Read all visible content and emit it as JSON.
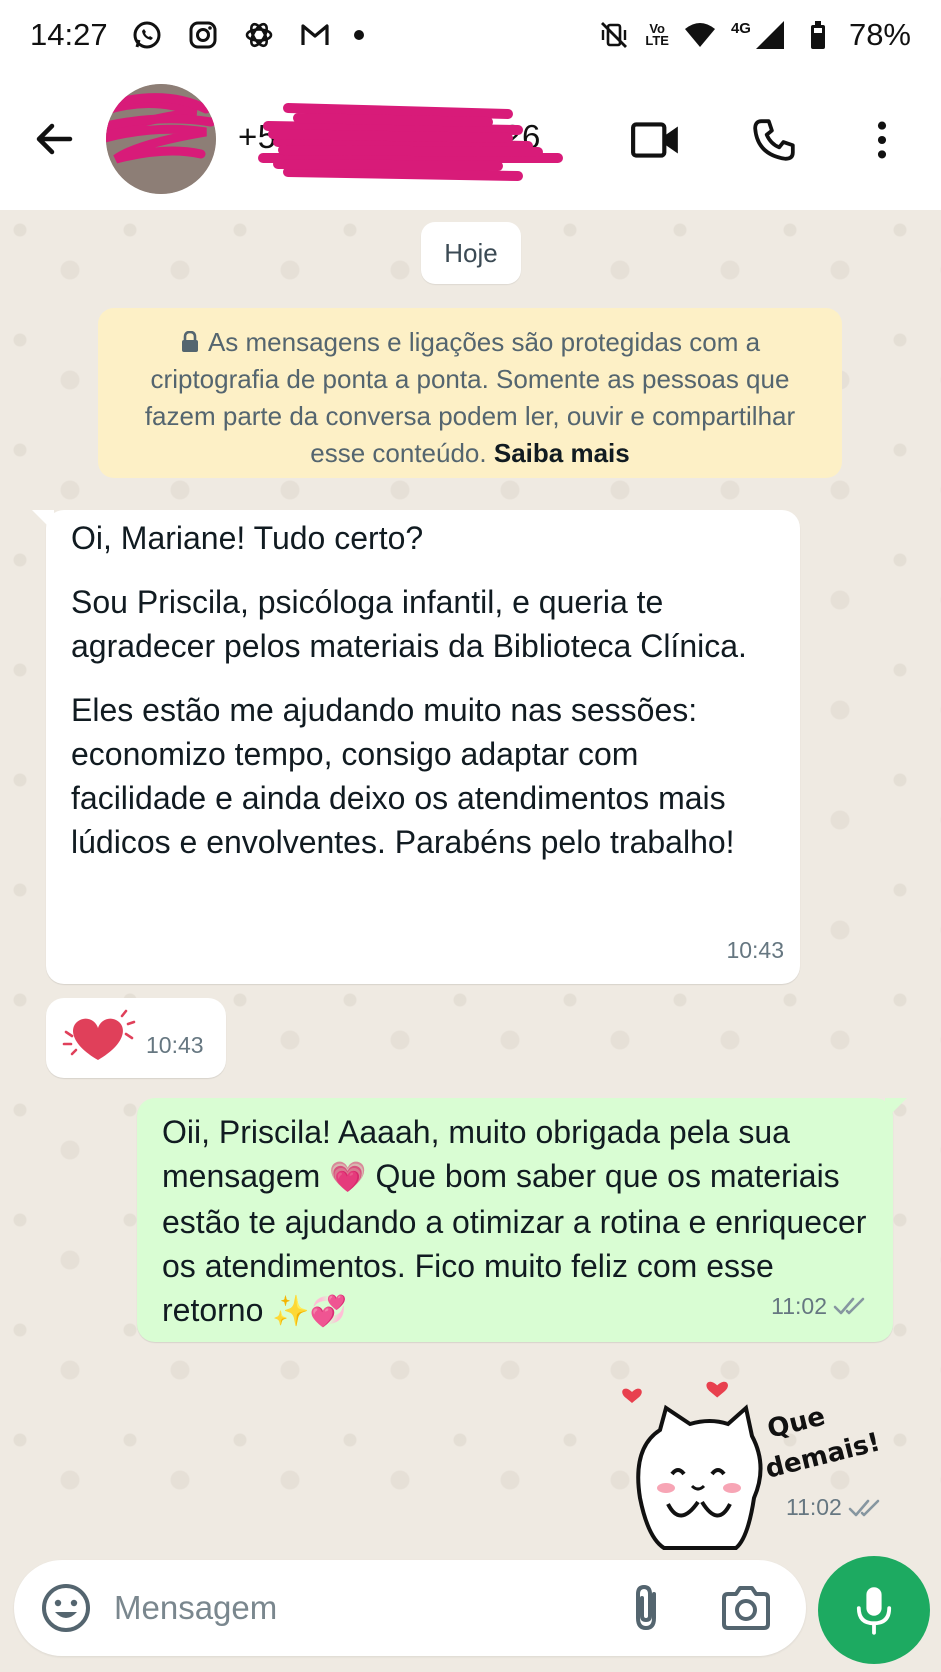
{
  "status_bar": {
    "time": "14:27",
    "network": "4G",
    "volte": "Vo\nLTE",
    "battery": "78%",
    "notification_icons": [
      "whatsapp-icon",
      "instagram-icon",
      "openai-icon",
      "gmail-icon"
    ]
  },
  "header": {
    "contact_name": "+55 11 9 0000-0426",
    "icons": [
      "back-arrow-icon",
      "video-call-icon",
      "phone-icon",
      "more-vert-icon"
    ]
  },
  "chat": {
    "date_chip": "Hoje",
    "encryption_notice": {
      "text": "As mensagens e ligações são protegidas com a criptografia de ponta a ponta. Somente as pessoas que fazem parte da conversa podem ler, ouvir e compartilhar esse conteúdo.",
      "link": "Saiba mais"
    },
    "messages": [
      {
        "direction": "incoming",
        "paragraphs": [
          "Oi, Mariane! Tudo certo?",
          "Sou Priscila, psicóloga infantil, e queria te agradecer pelos materiais da Biblioteca Clínica.",
          "Eles estão me ajudando muito nas sessões: economizo tempo, consigo adaptar com facilidade e ainda deixo os atendimentos mais lúdicos e envolventes. Parabéns pelo trabalho!"
        ],
        "time": "10:43"
      },
      {
        "direction": "incoming",
        "type": "sticker-heart",
        "time": "10:43"
      },
      {
        "direction": "outgoing",
        "text_before_emoji": "Oii, Priscila! Aaaah, muito obrigada pela sua mensagem ",
        "emoji_1": "💗",
        "text_after_emoji": " Que bom saber que os materiais estão te ajudando a otimizar a rotina e enriquecer os atendimentos. Fico muito feliz com esse retorno ",
        "emoji_2": "✨💞",
        "time": "11:02",
        "status": "read"
      },
      {
        "direction": "outgoing",
        "type": "sticker",
        "sticker_text": "Que demais!",
        "time": "11:02",
        "status": "read"
      }
    ]
  },
  "composer": {
    "placeholder": "Mensagem",
    "value": ""
  },
  "colors": {
    "outgoing_bubble": "#d9fdd3",
    "incoming_bubble": "#ffffff",
    "mic_button": "#1daa61",
    "encryption_bg": "#fdf0c6",
    "chat_bg": "#efeae2",
    "redaction": "#d81b79"
  }
}
